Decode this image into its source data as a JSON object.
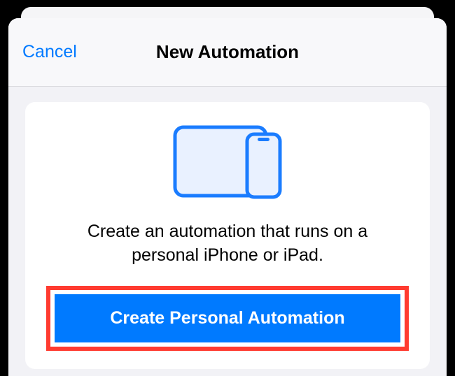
{
  "nav": {
    "cancel_label": "Cancel",
    "title": "New Automation"
  },
  "card": {
    "icon_name": "personal-devices-icon",
    "description": "Create an automation that runs on a personal iPhone or iPad.",
    "primary_button_label": "Create Personal Automation"
  },
  "colors": {
    "accent": "#007aff",
    "highlight": "#ff3b30"
  }
}
